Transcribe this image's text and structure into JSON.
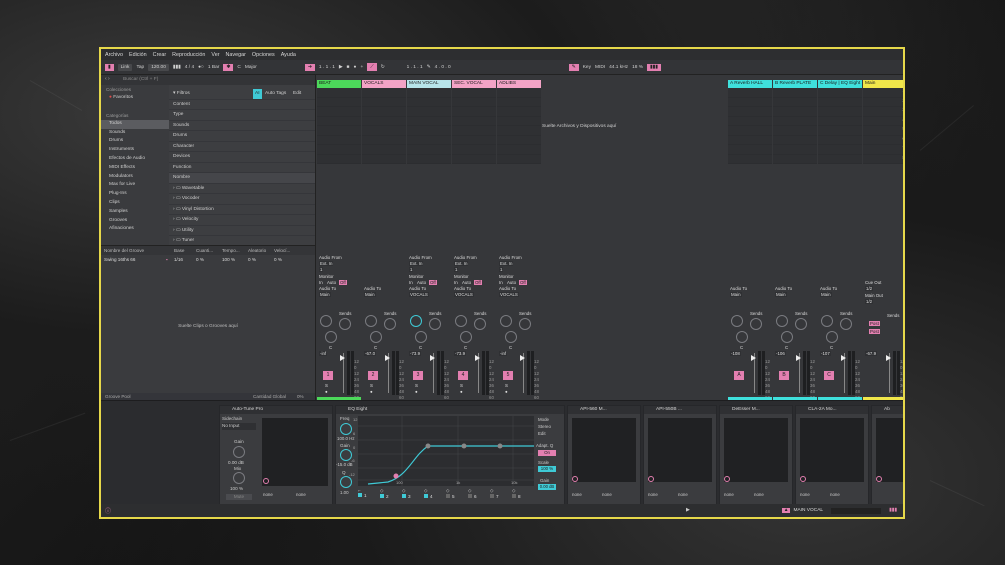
{
  "menu": [
    "Archivo",
    "Edición",
    "Crear",
    "Reproducción",
    "Ver",
    "Navegar",
    "Opciones",
    "Ayuda"
  ],
  "toolbar": {
    "link": "Link",
    "tap": "Tap",
    "bpm": "120.00",
    "sig": "4 / 4",
    "quant": "1 Bar",
    "key": "C",
    "scale": "Major",
    "pos1": "1 . 1 . 1",
    "pos2": "1 . 1 . 1",
    "len": "4 . 0 . 0",
    "key_label": "Key",
    "midi_label": "MIDI",
    "sr": "44.1 kHz",
    "cpu": "18 %"
  },
  "browser": {
    "search_placeholder": "Buscar (Ctrl + F)",
    "collections_head": "Colecciones",
    "favorites": "Favoritos",
    "categories_head": "Categorías",
    "categories": [
      "Todos",
      "Sounds",
      "Drums",
      "Instruments",
      "Efectos de Audio",
      "MIDI Effects",
      "Modulators",
      "Max for Live",
      "Plug-Ins",
      "Clips",
      "Samples",
      "Grooves",
      "Afinaciones"
    ],
    "filters": "Filtros",
    "auto_tags": "Auto Tags",
    "edit": "Edit",
    "filter_items": [
      "Content",
      "Type",
      "Sounds",
      "Drums",
      "Character",
      "Devices",
      "Function"
    ],
    "name_head": "Nombre",
    "results": [
      "Wavetable",
      "Vocoder",
      "Vinyl Distortion",
      "Velocity",
      "Utility",
      "Tuner"
    ],
    "selected": "1 item selected"
  },
  "groove": {
    "cols": [
      "Nombre del Groove",
      "Base",
      "Cuanti...",
      "Tempo...",
      "Aleatorio",
      "Velocí..."
    ],
    "row": [
      "Swing 16ths 66",
      "1/16",
      "0 %",
      "100 %",
      "0 %",
      "0 %"
    ],
    "drop": "Suelte Clips o Grooves aquí",
    "pool": "Groove Pool",
    "global": "Cantidad Global",
    "global_val": "0%"
  },
  "session": {
    "drop": "Suelte Archivos y Dispositivos aquí",
    "tracks": [
      {
        "name": "BEAT",
        "color": "#4cd85a",
        "num": "1",
        "vol": "-inf"
      },
      {
        "name": "VOCALS",
        "color": "#f3a3c6",
        "num": "2",
        "vol": "-67.0"
      },
      {
        "name": "MAIN VOCAL",
        "color": "#b7e4ea",
        "num": "3",
        "vol": "-73.9"
      },
      {
        "name": "SEC. VOCAL",
        "color": "#f3a3c6",
        "num": "4",
        "vol": "-73.9"
      },
      {
        "name": "ADLIBS",
        "color": "#f3a3c6",
        "num": "5",
        "vol": "-inf"
      }
    ],
    "returns": [
      {
        "name": "A Reverb HALL",
        "color": "#3fe0dc",
        "letter": "A",
        "vol": "-108"
      },
      {
        "name": "B Reverb PLATE",
        "color": "#3fe0dc",
        "letter": "B",
        "vol": "-106"
      },
      {
        "name": "C Delay | EQ Eight",
        "color": "#3fe0dc",
        "letter": "C",
        "vol": "-107"
      }
    ],
    "master": {
      "name": "Main",
      "color": "#f0e64a",
      "vol": "-67.9",
      "cue": "Cue Out",
      "main_out": "Main Out"
    },
    "scenes": [
      "1",
      "2",
      "3",
      "4",
      "5",
      "6",
      "7",
      "8"
    ],
    "audio_from": "Audio From",
    "ext_in": "Ext. In",
    "monitor": "Monitor",
    "in": "In",
    "auto": "Auto",
    "off": "Off",
    "audio_to": "Audio To",
    "main": "Main",
    "vocals": "VOCALS",
    "sends": "Sends",
    "post": "Post",
    "scale_ticks": [
      "12",
      "0",
      "12",
      "24",
      "36",
      "48",
      "60"
    ]
  },
  "devices": {
    "autotune": {
      "title": "Auto-Tune Pro",
      "sidechain": "Sidechain",
      "no_input": "No Input",
      "gain": "Gain",
      "gain_val": "0.00 dB",
      "mix": "Mix",
      "mix_val": "100 %",
      "mute": "Mute",
      "none": "none"
    },
    "eq": {
      "title": "EQ Eight",
      "freq": "Freq",
      "freq_val": "100.0 Hz",
      "gain": "Gain",
      "gain_val": "-15.0 dB",
      "q": "Q",
      "q_val": "1.00",
      "mode": "Mode",
      "stereo": "Stereo",
      "edit": "Edit",
      "adapt_q": "Adapt. Q",
      "on": "On",
      "scale": "Scale",
      "scale_val": "100 %",
      "gain2": "Gain",
      "gain2_val": "0.00 dB",
      "bands": [
        "1",
        "2",
        "3",
        "4",
        "5",
        "6",
        "7",
        "8"
      ],
      "yaxis": [
        "12",
        "6",
        "0",
        "-6",
        "-12"
      ],
      "xaxis": [
        "100",
        "1k",
        "10k"
      ]
    },
    "others": [
      "API-560 M...",
      "API-550B ...",
      "DeEsser M...",
      "CLA-2A Mo...",
      "Ab"
    ]
  },
  "status": {
    "track": "MAIN VOCAL"
  },
  "colors": {
    "pink": "#e37fb0",
    "teal": "#3fcad6",
    "yellow": "#e6d84a",
    "green": "#4cd85a"
  }
}
